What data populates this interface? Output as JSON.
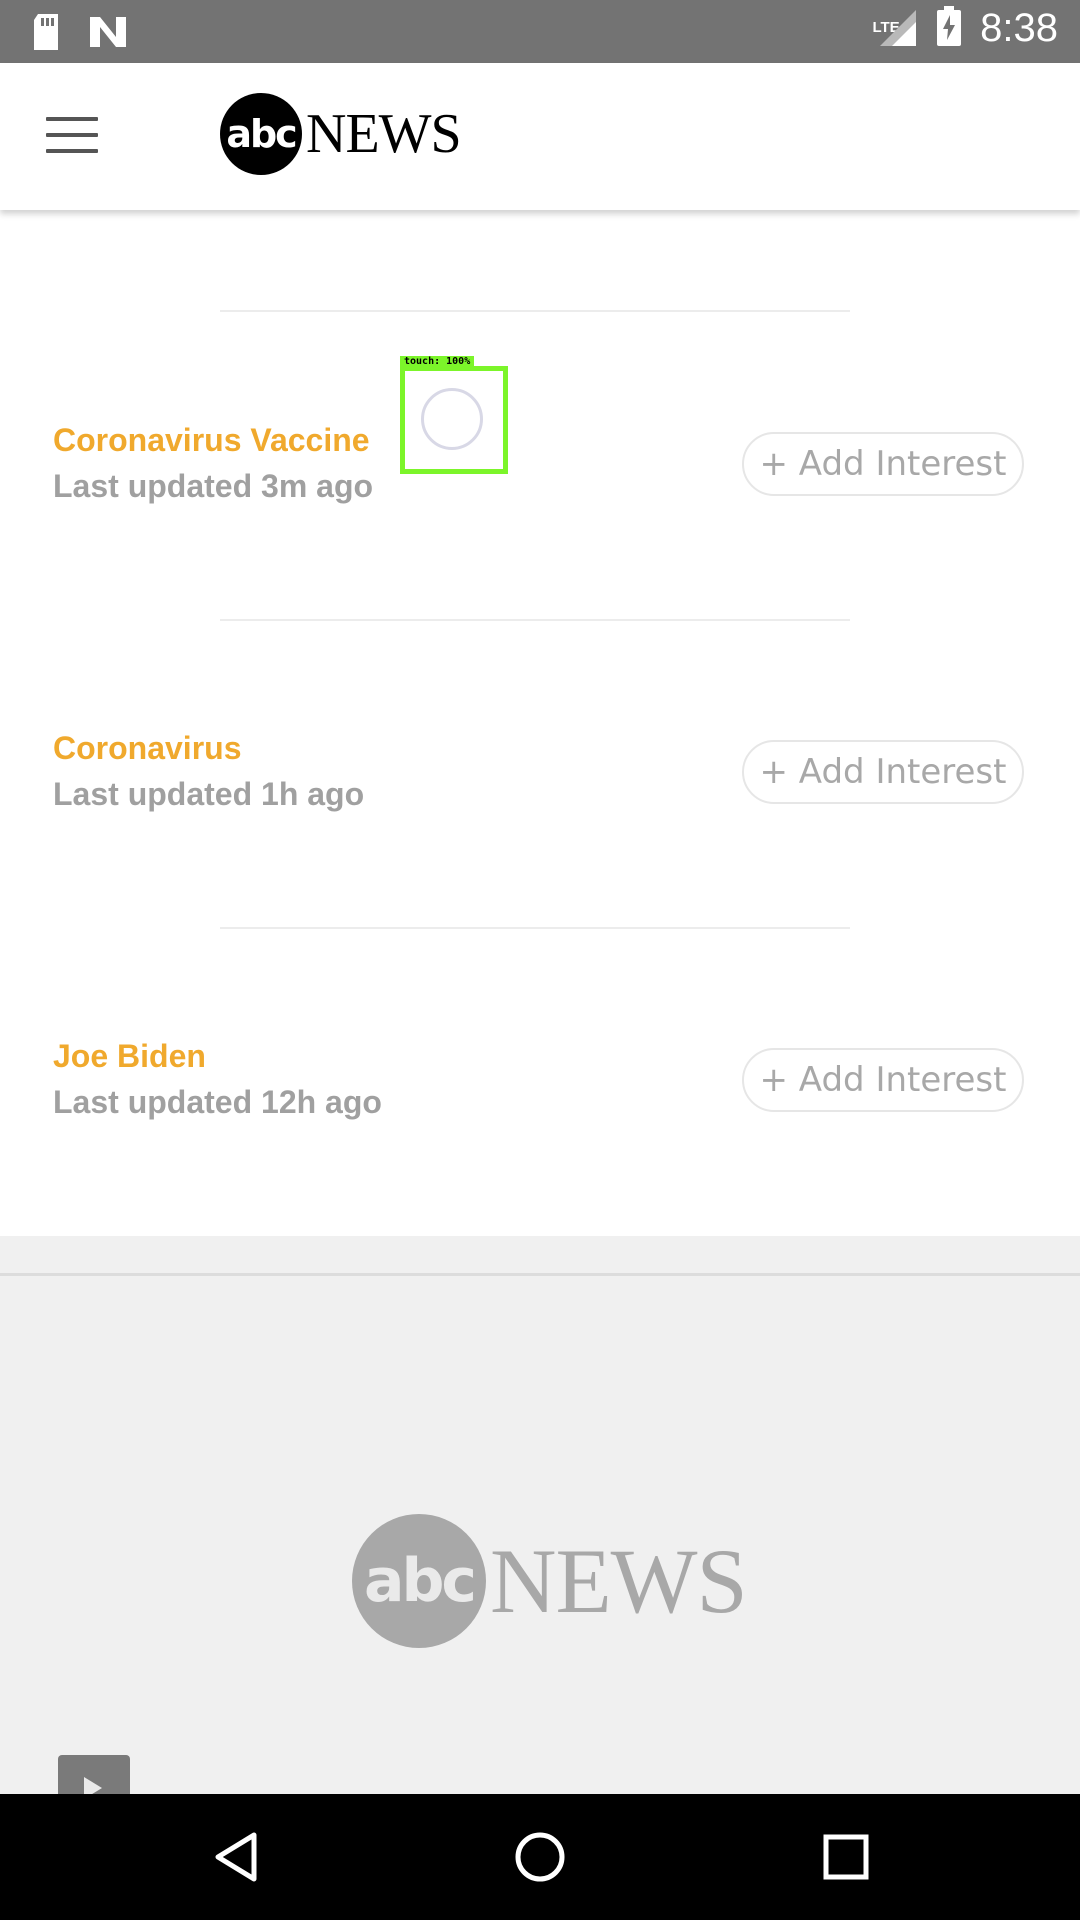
{
  "status_bar": {
    "time": "8:38",
    "network": "LTE",
    "icons": [
      "sd-card-icon",
      "n-logo-icon",
      "signal-icon",
      "battery-charging-icon"
    ]
  },
  "header": {
    "logo_mark": "abc",
    "logo_text": "NEWS",
    "menu_icon": "hamburger-menu-icon"
  },
  "topics": [
    {
      "title": "Coronavirus Vaccine",
      "updated": "Last updated 3m ago",
      "button": "+ Add Interest"
    },
    {
      "title": "Coronavirus",
      "updated": "Last updated 1h ago",
      "button": "+ Add Interest"
    },
    {
      "title": "Joe Biden",
      "updated": "Last updated 12h ago",
      "button": "+ Add Interest"
    }
  ],
  "touch_overlay": {
    "label": "touch: 100%"
  },
  "footer_logo": {
    "mark": "abc",
    "text": "NEWS"
  },
  "nav": {
    "icons": [
      "back-icon",
      "home-icon",
      "recents-icon"
    ]
  },
  "colors": {
    "accent": "#f0a92d",
    "muted": "#a0a0a0",
    "status_bar": "#737373",
    "nav_bar": "#000000"
  }
}
